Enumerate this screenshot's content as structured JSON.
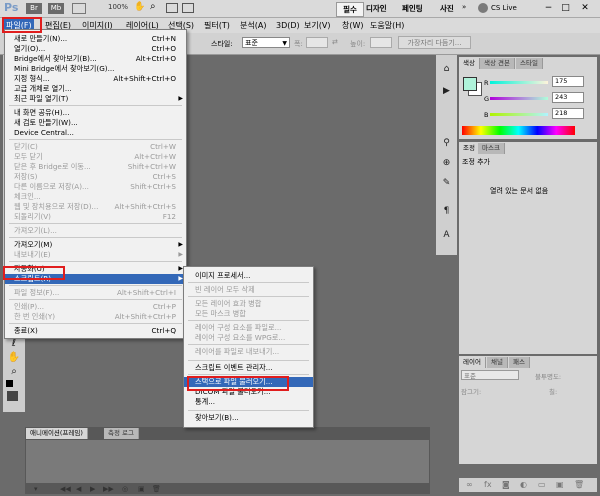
{
  "titlebar": {
    "logo": "Ps",
    "zoom": "100%",
    "workspaces": [
      "필수",
      "디자인",
      "페인팅",
      "사진"
    ],
    "cslive": "CS Live",
    "window_buttons": [
      "−",
      "□",
      "✕"
    ]
  },
  "menubar": {
    "items": [
      "파일(F)",
      "편집(E)",
      "이미지(I)",
      "레이어(L)",
      "선택(S)",
      "필터(T)",
      "분석(A)",
      "3D(D)",
      "보기(V)",
      "창(W)",
      "도움말(H)"
    ]
  },
  "optionsbar": {
    "style_label": "스타일:",
    "style_value": "표준",
    "width_label": "폭:",
    "height_label": "높이:",
    "refine_button": "가장자리 다듬기..."
  },
  "file_menu": {
    "items": [
      {
        "label": "새로 만들기(N)...",
        "shortcut": "Ctrl+N",
        "disabled": false
      },
      {
        "label": "열기(O)...",
        "shortcut": "Ctrl+O",
        "disabled": false
      },
      {
        "label": "Bridge에서 찾아보기(B)...",
        "shortcut": "Alt+Ctrl+O",
        "disabled": false
      },
      {
        "label": "Mini Bridge에서 찾아보기(G)...",
        "shortcut": "",
        "disabled": false
      },
      {
        "label": "지정 형식...",
        "shortcut": "Alt+Shift+Ctrl+O",
        "disabled": false
      },
      {
        "label": "고급 개체로 열기...",
        "shortcut": "",
        "disabled": false
      },
      {
        "label": "최근 파일 열기(T)",
        "shortcut": "",
        "disabled": false,
        "submenu": true
      },
      {
        "label": "내 화면 공유(H)...",
        "shortcut": "",
        "disabled": false
      },
      {
        "label": "새 검토 만들기(W)...",
        "shortcut": "",
        "disabled": false
      },
      {
        "label": "Device Central...",
        "shortcut": "",
        "disabled": false
      },
      {
        "label": "닫기(C)",
        "shortcut": "Ctrl+W",
        "disabled": true
      },
      {
        "label": "모두 닫기",
        "shortcut": "Alt+Ctrl+W",
        "disabled": true
      },
      {
        "label": "닫은 후 Bridge로 이동...",
        "shortcut": "Shift+Ctrl+W",
        "disabled": true
      },
      {
        "label": "저장(S)",
        "shortcut": "Ctrl+S",
        "disabled": true
      },
      {
        "label": "다른 이름으로 저장(A)...",
        "shortcut": "Shift+Ctrl+S",
        "disabled": true
      },
      {
        "label": "체크인...",
        "shortcut": "",
        "disabled": true
      },
      {
        "label": "웹 및 장치용으로 저장(D)...",
        "shortcut": "Alt+Shift+Ctrl+S",
        "disabled": true
      },
      {
        "label": "되돌리기(V)",
        "shortcut": "F12",
        "disabled": true
      },
      {
        "label": "가져오기(L)...",
        "shortcut": "",
        "disabled": true
      },
      {
        "label": "가져오기(M)",
        "shortcut": "",
        "disabled": false,
        "submenu": true
      },
      {
        "label": "내보내기(E)",
        "shortcut": "",
        "disabled": true,
        "submenu": true
      },
      {
        "label": "자동화(U)",
        "shortcut": "",
        "disabled": false,
        "submenu": true
      },
      {
        "label": "스크립트(R)",
        "shortcut": "",
        "disabled": false,
        "submenu": true
      },
      {
        "label": "파일 정보(F)...",
        "shortcut": "Alt+Shift+Ctrl+I",
        "disabled": true
      },
      {
        "label": "인쇄(P)...",
        "shortcut": "Ctrl+P",
        "disabled": true
      },
      {
        "label": "한 번 인쇄(Y)",
        "shortcut": "Alt+Shift+Ctrl+P",
        "disabled": true
      },
      {
        "label": "종료(X)",
        "shortcut": "Ctrl+Q",
        "disabled": false
      }
    ]
  },
  "scripts_submenu": {
    "items": [
      {
        "label": "이미지 프로세서...",
        "disabled": false
      },
      {
        "label": "빈 레이어 모두 삭제",
        "disabled": true
      },
      {
        "label": "모든 레이어 효과 병합",
        "disabled": true
      },
      {
        "label": "모든 마스크 병합",
        "disabled": true
      },
      {
        "label": "레이어 구성 요소를 파일로...",
        "disabled": true
      },
      {
        "label": "레이어 구성 요소를 WPG로...",
        "disabled": true
      },
      {
        "label": "레이어를 파일로 내보내기...",
        "disabled": true
      },
      {
        "label": "스크립트 이벤트 관리자...",
        "disabled": false
      },
      {
        "label": "스택으로 파일 불러오기...",
        "disabled": false
      },
      {
        "label": "DICOM 파일 불러오기...",
        "disabled": false
      },
      {
        "label": "통계...",
        "disabled": false
      },
      {
        "label": "찾아보기(B)...",
        "disabled": false
      }
    ]
  },
  "color_panel": {
    "tabs": [
      "색상",
      "색상 견본",
      "스타일"
    ],
    "r_label": "R",
    "g_label": "G",
    "b_label": "B",
    "r_value": "175",
    "g_value": "243",
    "b_value": "218",
    "swatch_color": "#aff3da"
  },
  "adjust_panel": {
    "tabs": [
      "조정",
      "마스크"
    ],
    "title": "조정 추가",
    "message": "열려 있는 문서 없음"
  },
  "layers_panel": {
    "tabs": [
      "레이어",
      "채널",
      "패스"
    ],
    "mode": "표준",
    "opacity_label": "불투명도:",
    "lock_label": "잠그기:",
    "fill_label": "칠:"
  },
  "bottom_tabs": [
    "애니메이션(프레임)",
    "측정 로그"
  ],
  "colors": {
    "menu_highlight": "#3368b8",
    "annotation_red": "#e01d1d",
    "canvas_bg": "#6b6b6b"
  }
}
